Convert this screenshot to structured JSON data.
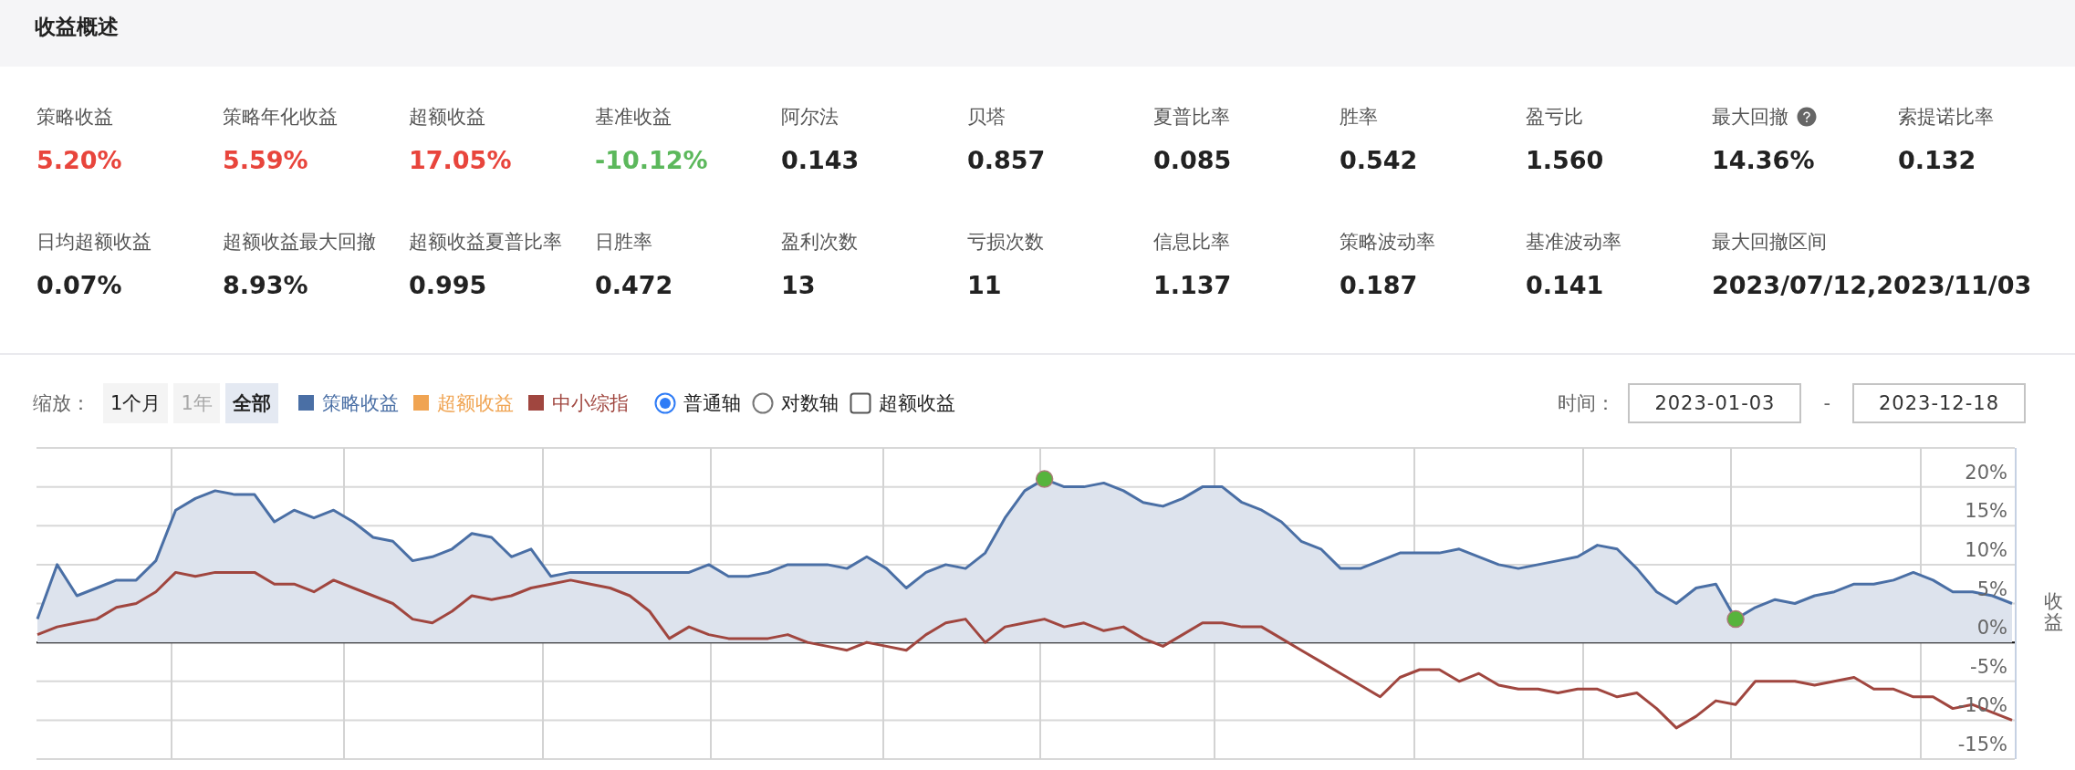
{
  "header": {
    "title": "收益概述"
  },
  "metrics": [
    {
      "label": "策略收益",
      "value": "5.20%",
      "color": "#e8453c",
      "help": false
    },
    {
      "label": "策略年化收益",
      "value": "5.59%",
      "color": "#e8453c",
      "help": false
    },
    {
      "label": "超额收益",
      "value": "17.05%",
      "color": "#e8453c",
      "help": false
    },
    {
      "label": "基准收益",
      "value": "-10.12%",
      "color": "#5cb85c",
      "help": false
    },
    {
      "label": "阿尔法",
      "value": "0.143",
      "color": "#222222",
      "help": false
    },
    {
      "label": "贝塔",
      "value": "0.857",
      "color": "#222222",
      "help": false
    },
    {
      "label": "夏普比率",
      "value": "0.085",
      "color": "#222222",
      "help": false
    },
    {
      "label": "胜率",
      "value": "0.542",
      "color": "#222222",
      "help": false
    },
    {
      "label": "盈亏比",
      "value": "1.560",
      "color": "#222222",
      "help": false
    },
    {
      "label": "最大回撤",
      "value": "14.36%",
      "color": "#222222",
      "help": true
    },
    {
      "label": "索提诺比率",
      "value": "0.132",
      "color": "#222222",
      "help": false
    },
    {
      "label": "日均超额收益",
      "value": "0.07%",
      "color": "#222222",
      "help": false
    },
    {
      "label": "超额收益最大回撤",
      "value": "8.93%",
      "color": "#222222",
      "help": false
    },
    {
      "label": "超额收益夏普比率",
      "value": "0.995",
      "color": "#222222",
      "help": false
    },
    {
      "label": "日胜率",
      "value": "0.472",
      "color": "#222222",
      "help": false
    },
    {
      "label": "盈利次数",
      "value": "13",
      "color": "#222222",
      "help": false
    },
    {
      "label": "亏损次数",
      "value": "11",
      "color": "#222222",
      "help": false
    },
    {
      "label": "信息比率",
      "value": "1.137",
      "color": "#222222",
      "help": false
    },
    {
      "label": "策略波动率",
      "value": "0.187",
      "color": "#222222",
      "help": false
    },
    {
      "label": "基准波动率",
      "value": "0.141",
      "color": "#222222",
      "help": false
    },
    {
      "label": "最大回撤区间",
      "value": "2023/07/12,2023/11/03",
      "color": "#222222",
      "help": false
    }
  ],
  "toolbar": {
    "zoom_label": "缩放：",
    "zoom_buttons": [
      {
        "label": "1个月",
        "selected": false,
        "disabled": false
      },
      {
        "label": "1年",
        "selected": false,
        "disabled": true
      },
      {
        "label": "全部",
        "selected": true,
        "disabled": false
      }
    ],
    "legend": [
      {
        "label": "策略收益",
        "color": "#4a6fa5"
      },
      {
        "label": "超额收益",
        "color": "#f0a452"
      },
      {
        "label": "中小综指",
        "color": "#a0463f"
      }
    ],
    "axis_options": [
      {
        "label": "普通轴",
        "selected": true
      },
      {
        "label": "对数轴",
        "selected": false
      }
    ],
    "excess_toggle": {
      "label": "超额收益",
      "checked": false
    },
    "date_range": {
      "label": "时间：",
      "start": "2023-01-03",
      "separator": "-",
      "end": "2023-12-18"
    }
  },
  "chart": {
    "chart_data": {
      "type": "line",
      "grid": true,
      "ylabel": "收益",
      "ylim": [
        -15,
        25
      ],
      "yticks": [
        {
          "value": -15,
          "label": "-15%"
        },
        {
          "value": -10,
          "label": "-10%"
        },
        {
          "value": -5,
          "label": "-5%"
        },
        {
          "value": 0,
          "label": "0%"
        },
        {
          "value": 5,
          "label": "5%"
        },
        {
          "value": 10,
          "label": "10%"
        },
        {
          "value": 15,
          "label": "15%"
        },
        {
          "value": 20,
          "label": "20%"
        }
      ],
      "series": [
        {
          "color": "#4a6fa5",
          "type": "area",
          "values": [
            3,
            10,
            6,
            7,
            8,
            8,
            10.5,
            17,
            18.5,
            19.5,
            19,
            19,
            15.5,
            17,
            16,
            17,
            15.5,
            13.5,
            13,
            10.5,
            11,
            12,
            14,
            13.5,
            11,
            12,
            8.5,
            9,
            9,
            9,
            9,
            9,
            9,
            9,
            10,
            8.5,
            8.5,
            9,
            10,
            10,
            10,
            9.5,
            11,
            9.5,
            7,
            9,
            10,
            9.5,
            11.5,
            16,
            19.5,
            21,
            20,
            20,
            20.5,
            19.5,
            18,
            17.5,
            18.5,
            20,
            20,
            18,
            17,
            15.5,
            13,
            12,
            9.5,
            9.5,
            10.5,
            11.5,
            11.5,
            11.5,
            12,
            11,
            10,
            9.5,
            10,
            10.5,
            11,
            12.5,
            12,
            9.5,
            6.5,
            5,
            7,
            7.5,
            3,
            4.5,
            5.5,
            5,
            6,
            6.5,
            7.5,
            7.5,
            8,
            9,
            8,
            6.5,
            6.5,
            6,
            5
          ]
        },
        {
          "color": "#a0463f",
          "type": "line",
          "values": [
            1,
            2,
            2.5,
            3,
            4.5,
            5,
            6.5,
            9,
            8.5,
            9,
            9,
            9,
            7.5,
            7.5,
            6.5,
            8,
            7,
            6,
            5,
            3,
            2.5,
            4,
            6,
            5.5,
            6,
            7,
            7.5,
            8,
            7.5,
            7,
            6,
            4,
            0.5,
            2,
            1,
            0.5,
            0.5,
            0.5,
            1,
            0,
            -0.5,
            -1,
            0,
            -0.5,
            -1,
            1,
            2.5,
            3,
            0,
            2,
            2.5,
            3,
            2,
            2.5,
            1.5,
            2,
            0.5,
            -0.5,
            1,
            2.5,
            2.5,
            2,
            2,
            0.5,
            -1,
            -2.5,
            -4,
            -5.5,
            -7,
            -4.5,
            -3.5,
            -3.5,
            -5,
            -4,
            -5.5,
            -6,
            -6,
            -6.5,
            -6,
            -6,
            -7,
            -6.5,
            -8.5,
            -11,
            -9.5,
            -7.5,
            -8,
            -5,
            -5,
            -5,
            -5.5,
            -5,
            -4.5,
            -6,
            -6,
            -7,
            -7,
            -8.5,
            -8,
            -9,
            -10
          ]
        }
      ]
    }
  }
}
